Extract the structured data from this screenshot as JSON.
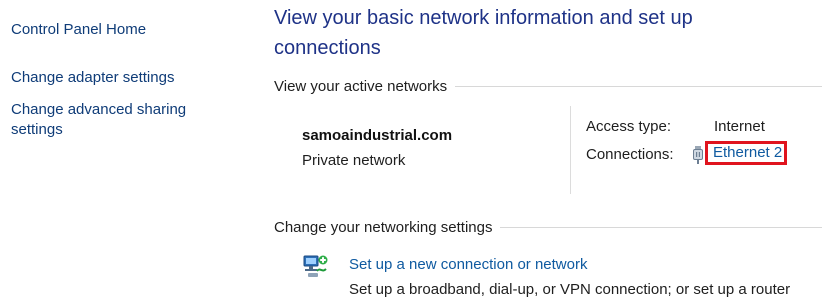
{
  "left_nav": {
    "home": "Control Panel Home",
    "adapter": "Change adapter settings",
    "sharing": "Change advanced sharing settings"
  },
  "main": {
    "title": "View your basic network information and set up connections",
    "active_networks_header": "View your active networks",
    "network": {
      "name": "samoaindustrial.com",
      "category": "Private network",
      "access_type_label": "Access type:",
      "access_type_value": "Internet",
      "connections_label": "Connections:",
      "connection_link": "Ethernet 2",
      "connection_icon": "ethernet-plug-icon"
    },
    "change_settings_header": "Change your networking settings",
    "tasks": [
      {
        "icon": "new-connection-icon",
        "link": "Set up a new connection or network",
        "description": "Set up a broadband, dial-up, or VPN connection; or set up a router"
      }
    ]
  },
  "colors": {
    "title": "#1e3287",
    "link": "#0f5aa0",
    "highlight_box": "#e0141e"
  }
}
